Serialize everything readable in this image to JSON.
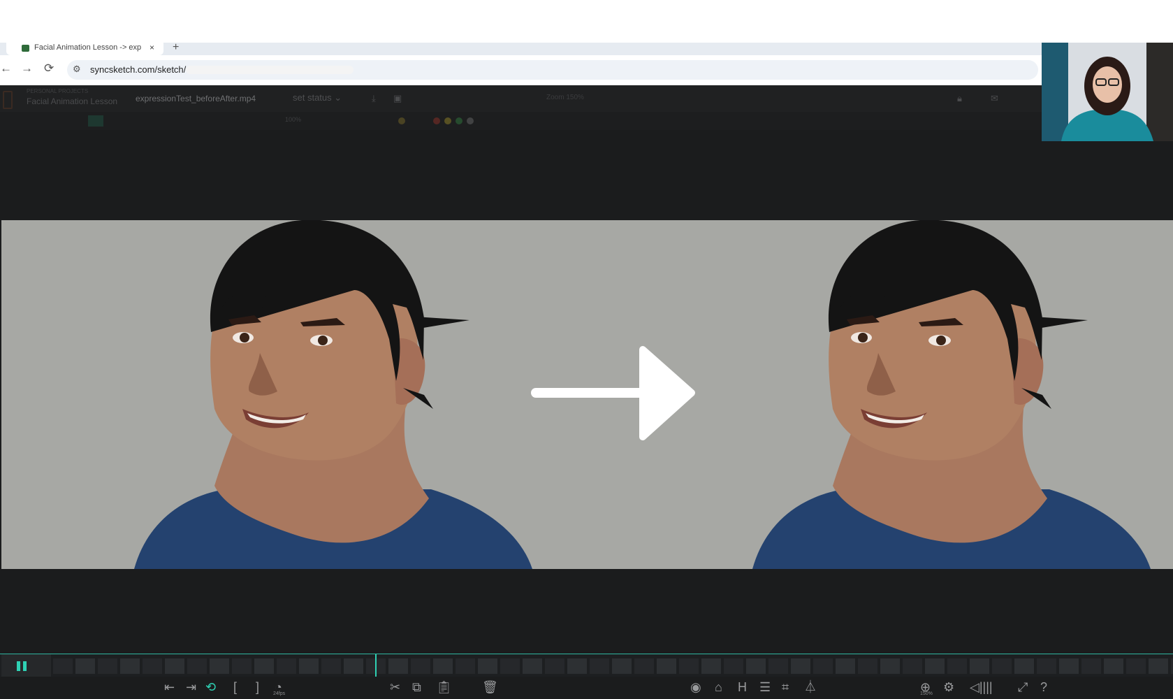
{
  "browser": {
    "tab_title": "Facial Animation Lesson -> exp",
    "tab_close": "×",
    "new_tab": "+",
    "back": "←",
    "forward": "→",
    "reload": "⟳",
    "url": "syncsketch.com/sketch/"
  },
  "app": {
    "project_label": "PERSONAL PROJECTS",
    "project_name": "Facial Animation Lesson",
    "file_name": "expressionTest_beforeAfter.mp4",
    "set_status": "set status ⌄",
    "zoom_label": "Zoom 150%",
    "toolbar_zoom": "100%"
  },
  "player": {
    "fps_label": "24fps",
    "zoom_label": "150%",
    "playhead_fraction": 0.32
  },
  "colors": {
    "accent": "#2fd1b4",
    "background": "#1b1c1d",
    "video_bg": "#a7a8a4",
    "shirt": "#24426f",
    "skin": "#a9785f",
    "hair": "#141414"
  },
  "icons": [
    "keyframe-prev-icon",
    "keyframe-next-icon",
    "loop-icon",
    "in-point-icon",
    "out-point-icon",
    "fps-icon",
    "cut-icon",
    "copy-icon",
    "paste-icon",
    "delete-icon",
    "eye-icon",
    "ghost-icon",
    "h-flip-icon",
    "layers-icon",
    "crop-icon",
    "mirror-icon",
    "zoom-icon",
    "settings-icon",
    "volume-icon",
    "fullscreen-icon",
    "help-icon"
  ]
}
